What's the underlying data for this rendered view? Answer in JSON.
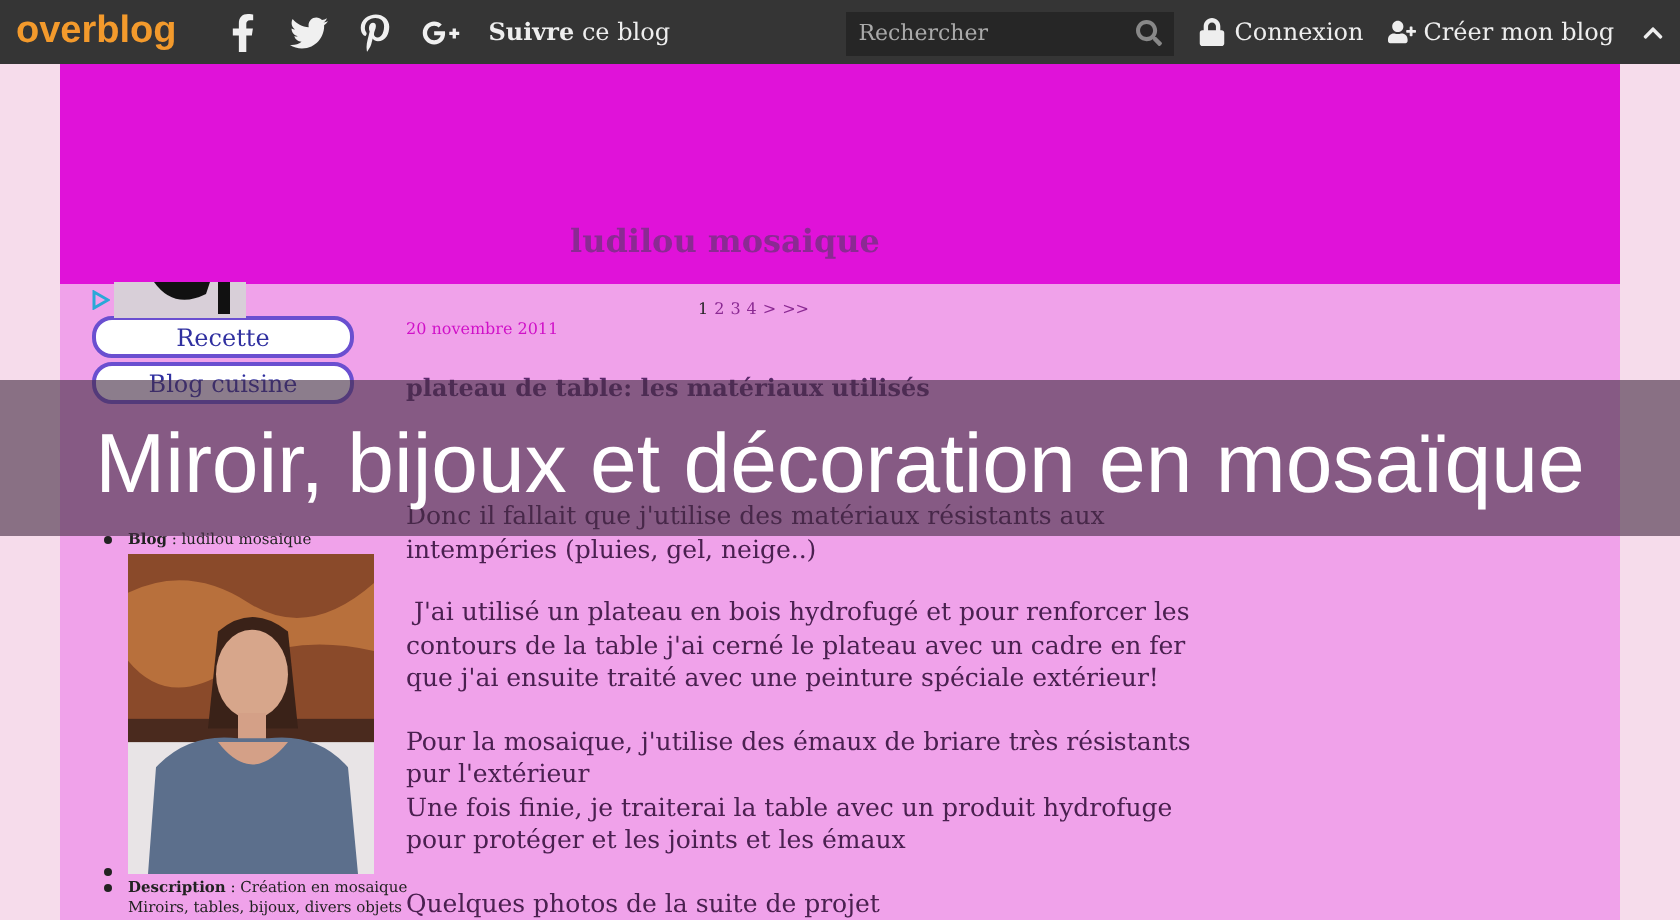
{
  "topbar": {
    "logo": "overblog",
    "social": [
      {
        "kind": "facebook"
      },
      {
        "kind": "twitter"
      },
      {
        "kind": "pinterest"
      },
      {
        "kind": "googleplus"
      }
    ],
    "follow": "**Suivre** ce blog",
    "search": {
      "placeholder": "Rechercher"
    },
    "links": [
      {
        "kind": "login",
        "label": "Connexion"
      },
      {
        "kind": "signup",
        "label": "Créer mon blog"
      }
    ]
  },
  "header": {
    "title": "ludilou mosaique"
  },
  "sidebar": {
    "buttons": [
      "Recette",
      "Blog cuisine"
    ],
    "blog": "**Blog** : ludilou mosaique",
    "description": [
      "**Description** : Création en mosaique",
      "Miroirs, tables, bijoux, divers objets"
    ]
  },
  "pagination": [
    {
      "label": "1",
      "selected": true
    },
    {
      "label": "2",
      "selected": false
    },
    {
      "label": "3",
      "selected": false
    },
    {
      "label": "4",
      "selected": false
    },
    {
      "label": ">",
      "selected": false
    },
    {
      "label": ">>",
      "selected": false
    }
  ],
  "post": {
    "date": "20 novembre 2011",
    "title": "plateau de table: les matériaux utilisés",
    "paragraphs": [
      [
        "Donc il fallait que j'utilise des matériaux résistants aux",
        "intempéries (pluies, gel, neige..)"
      ],
      [
        " J'ai utilisé un plateau en bois hydrofugé et pour renforcer les",
        "contours de la table j'ai cerné le plateau avec un cadre en fer",
        "que j'ai ensuite traité avec une peinture spéciale extérieur!"
      ],
      [
        "Pour la mosaique, j'utilise des émaux de briare très résistants",
        "pur l'extérieur",
        "Une fois finie, je traiterai la table avec un produit hydrofuge",
        "pour protéger et les joints et les émaux"
      ],
      [
        "Quelques photos de la suite de projet"
      ]
    ]
  },
  "banner": {
    "title": "Miroir, bijoux et décoration en mosaïque"
  }
}
